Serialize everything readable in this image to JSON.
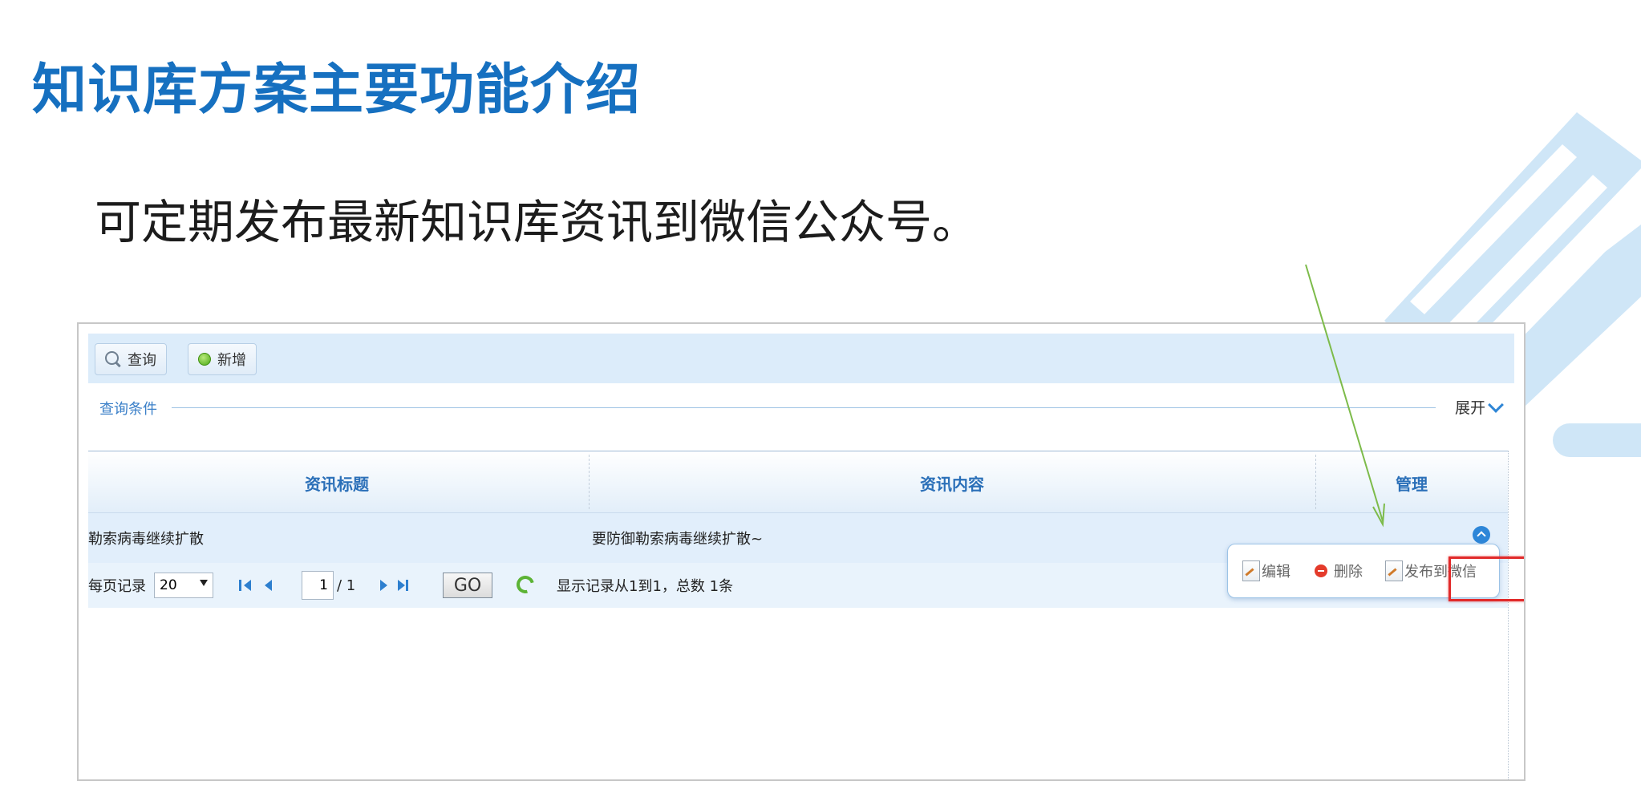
{
  "slide": {
    "title": "知识库方案主要功能介绍",
    "subtitle": "可定期发布最新知识库资讯到微信公众号。"
  },
  "colors": {
    "title_blue": "#1670c0",
    "decor_light_blue": "#cfe6f7",
    "highlight_red": "#e12a2a",
    "annotation_green": "#7dbb4a"
  },
  "toolbar": {
    "search_label": "查询",
    "add_label": "新增"
  },
  "query": {
    "label": "查询条件",
    "expand_label": "展开"
  },
  "table": {
    "columns": [
      "资讯标题",
      "资讯内容",
      "管理"
    ],
    "rows": [
      {
        "title": "勒索病毒继续扩散",
        "content": "要防御勒索病毒继续扩散~"
      }
    ]
  },
  "pager": {
    "per_page_label": "每页记录",
    "per_page_value": "20",
    "current_page": "1",
    "total_pages": "/ 1",
    "go_label": "GO",
    "summary": "显示记录从1到1，总数 1条"
  },
  "actions_menu": {
    "edit_label": "编辑",
    "delete_label": "删除",
    "publish_label": "发布到微信"
  },
  "icons": [
    "search-icon",
    "add-icon",
    "chevron-down-icon",
    "collapse-up-icon",
    "first-page-icon",
    "prev-page-icon",
    "next-page-icon",
    "last-page-icon",
    "refresh-icon",
    "edit-icon",
    "delete-icon",
    "publish-icon"
  ]
}
